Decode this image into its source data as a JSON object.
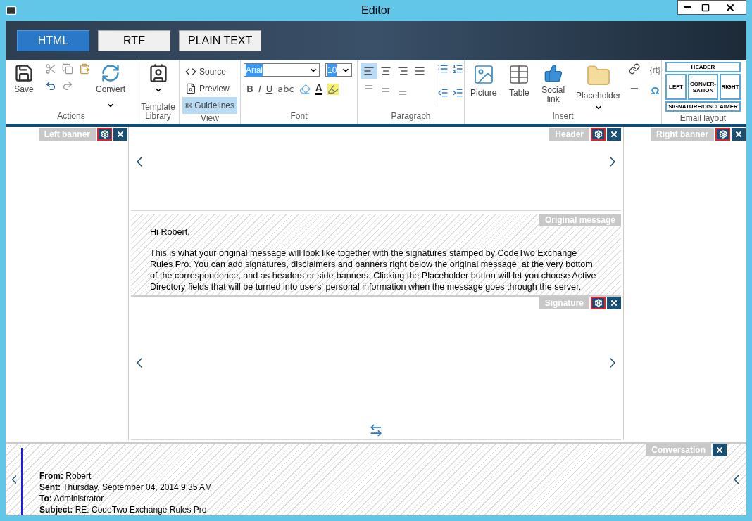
{
  "window": {
    "title": "Editor"
  },
  "format_tabs": [
    {
      "label": "HTML",
      "selected": true
    },
    {
      "label": "RTF",
      "selected": false
    },
    {
      "label": "PLAIN TEXT",
      "selected": false
    }
  ],
  "actions": {
    "label": "Actions",
    "save": "Save",
    "convert": "Convert"
  },
  "template": {
    "label": "Template Library"
  },
  "view": {
    "label": "View",
    "items": [
      {
        "kind": "source",
        "label": "Source",
        "selected": false
      },
      {
        "kind": "preview",
        "label": "Preview",
        "selected": false
      },
      {
        "kind": "guidelines",
        "label": "Guidelines",
        "selected": true
      }
    ]
  },
  "font": {
    "label": "Font",
    "family": "Arial",
    "size": "10",
    "styles": [
      {
        "kind": "bold",
        "label": "B"
      },
      {
        "kind": "italic",
        "label": "I"
      },
      {
        "kind": "underline",
        "label": "U"
      },
      {
        "kind": "strike",
        "label": "abc"
      }
    ],
    "color_letter": "A"
  },
  "paragraph": {
    "label": "Paragraph",
    "align": [
      {
        "kind": "left",
        "selected": true
      },
      {
        "kind": "center",
        "selected": false
      },
      {
        "kind": "right",
        "selected": false
      },
      {
        "kind": "justify",
        "selected": false
      }
    ]
  },
  "insert": {
    "label": "Insert",
    "items": [
      {
        "kind": "picture",
        "label": "Picture"
      },
      {
        "kind": "table",
        "label": "Table"
      },
      {
        "kind": "social",
        "label": "Social link"
      },
      {
        "kind": "placeholder",
        "label": "Placeholder"
      }
    ],
    "rt": "{rt}",
    "omega": "Ω"
  },
  "email_layout": {
    "label": "Email layout",
    "header": "HEADER",
    "left": "LEFT",
    "center": "CONVER-SATION",
    "right": "RIGHT",
    "footer": "SIGNATURE/DISCLAIMER"
  },
  "regions": {
    "left_banner": {
      "label": "Left banner",
      "settings": true
    },
    "header": {
      "label": "Header",
      "settings": true
    },
    "right_banner": {
      "label": "Right banner",
      "settings": true
    },
    "original_message": {
      "label": "Original message",
      "greeting": "Hi Robert,",
      "body": "This is what your original message will look like together with the signatures stamped by CodeTwo Exchange Rules Pro. You can add signatures, disclaimers and banners right below the original message, at the very bottom of the correspondence, and as headers or side-banners. Clicking the Placeholder button will let you choose Active Directory fields that will be turned into users' personal information when the message goes through the server."
    },
    "signature": {
      "label": "Signature",
      "settings": true
    },
    "conversation": {
      "label": "Conversation",
      "fields": [
        {
          "label": "From:",
          "value": "Robert"
        },
        {
          "label": "Sent:",
          "value": "Thursday, September 04, 2014 9:35 AM"
        },
        {
          "label": "To:",
          "value": "Administrator"
        },
        {
          "label": "Subject:",
          "value": "RE: CodeTwo Exchange Rules Pro"
        }
      ]
    }
  }
}
